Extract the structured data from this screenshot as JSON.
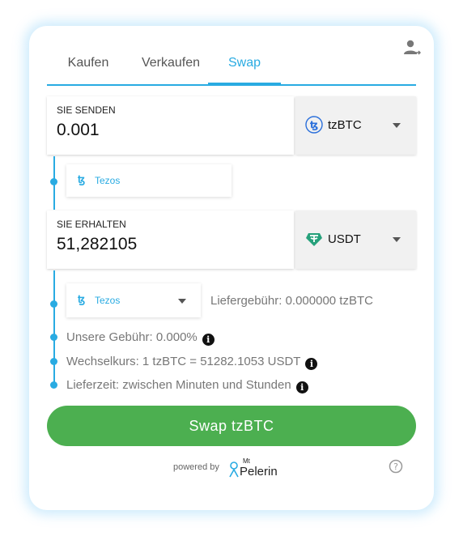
{
  "tabs": [
    {
      "label": "Kaufen"
    },
    {
      "label": "Verkaufen"
    },
    {
      "label": "Swap"
    }
  ],
  "active_tab": "Swap",
  "send": {
    "caption": "SIE SENDEN",
    "amount": "0.001",
    "token": "tzBTC",
    "token_icon": "tzbtc-icon",
    "network": "Tezos"
  },
  "receive": {
    "caption": "SIE ERHALTEN",
    "amount": "51,282105",
    "token": "USDT",
    "token_icon": "usdt-icon",
    "network": "Tezos"
  },
  "info": {
    "delivery_fee": "Liefergebühr: 0.000000 tzBTC",
    "our_fee": "Unsere Gebühr: 0.000%",
    "exchange_rate": "Wechselkurs: 1 tzBTC = 51282.1053 USDT",
    "delivery_time": "Lieferzeit: zwischen Minuten und Stunden"
  },
  "swap_button": "Swap tzBTC",
  "footer": {
    "powered_by": "powered by",
    "logo_top": "Mt",
    "logo_name": "Pelerin"
  },
  "colors": {
    "accent": "#29abe2",
    "button": "#4caf50",
    "usdt": "#26a17b"
  }
}
